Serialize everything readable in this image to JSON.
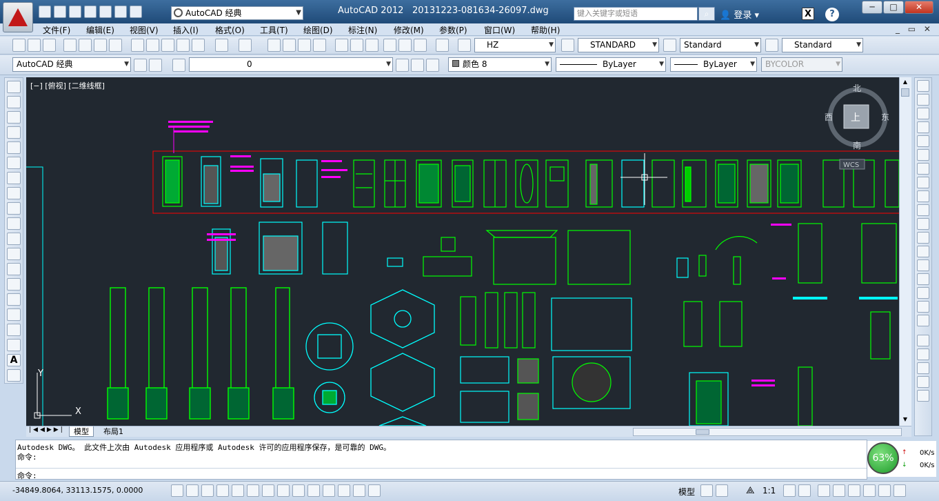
{
  "window": {
    "app_title": "AutoCAD 2012",
    "document_title": "20131223-081634-26097.dwg",
    "workspace": "AutoCAD 经典",
    "search_placeholder": "键入关键字或短语",
    "login_label": "登录",
    "exchange_label": "X",
    "help_label": "?",
    "minimize": "─",
    "restore": "□",
    "close": "✕"
  },
  "menu": [
    "文件(F)",
    "编辑(E)",
    "视图(V)",
    "插入(I)",
    "格式(O)",
    "工具(T)",
    "绘图(D)",
    "标注(N)",
    "修改(M)",
    "参数(P)",
    "窗口(W)",
    "帮助(H)"
  ],
  "styles_toolbar": {
    "text_style": "HZ",
    "dim_style": "STANDARD",
    "table_style": "Standard",
    "mleader_style": "Standard"
  },
  "layers_toolbar": {
    "workspace": "AutoCAD 经典",
    "layer": "0",
    "color": "颜色 8",
    "linetype": "ByLayer",
    "lineweight": "ByLayer",
    "plotstyle": "BYCOLOR"
  },
  "viewport": {
    "label": "[−] [俯视] [二维线框]",
    "viewcube_top": "上",
    "north": "北",
    "south": "南",
    "east": "东",
    "west": "西",
    "wcs": "WCS",
    "ucs_x": "X",
    "ucs_y": "Y"
  },
  "layout_tabs": [
    "模型",
    "布局1"
  ],
  "command": {
    "line1": "Autodesk DWG。  此文件上次由 Autodesk 应用程序或 Autodesk 许可的应用程序保存，是可靠的 DWG。",
    "line2": "命令:",
    "prompt": "命令:"
  },
  "network": {
    "percent": "63%",
    "up": "0K/s",
    "down": "0K/s"
  },
  "status": {
    "coordinates": "-34849.8064, 33113.1575, 0.0000",
    "model": "模型",
    "scale": "1:1"
  },
  "colors": {
    "canvas": "#212830",
    "cyan": "#00ffff",
    "green": "#00ff00",
    "magenta": "#ff00ff",
    "red": "#ff0000"
  }
}
